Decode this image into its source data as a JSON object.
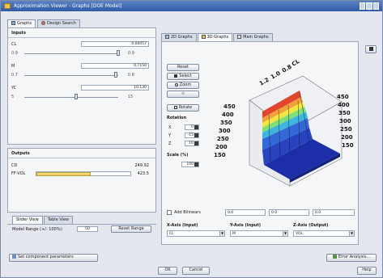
{
  "window": {
    "title": "Approximation Viewer - Graphs [DOE Model]"
  },
  "top_tabs": [
    {
      "label": "Graphs"
    },
    {
      "label": "Design Search"
    }
  ],
  "inputs": {
    "heading": "Inputs",
    "rows": [
      {
        "name": "CL",
        "value": "0.00057",
        "min": "0.9",
        "max": "0.9"
      },
      {
        "name": "M",
        "value": "0.7150",
        "min": "0.7",
        "max": "0.8"
      },
      {
        "name": "YC",
        "value": "10.130",
        "min": "5",
        "max": "15"
      }
    ]
  },
  "outputs": {
    "heading": "Outputs",
    "rows": [
      {
        "name": "CD",
        "value": "249.92"
      },
      {
        "name": "FF-VOL",
        "value": "423.5",
        "bar_fraction": 0.58
      }
    ]
  },
  "bottom_tabs": [
    {
      "label": "Slider View"
    },
    {
      "label": "Table View"
    }
  ],
  "model_range": {
    "label": "Model Range (+/- 100%):",
    "value": "50",
    "reset_label": "Reset Range"
  },
  "right_tabs": [
    {
      "label": "2D Graphs"
    },
    {
      "label": "3D Graphs"
    },
    {
      "label": "Main Graphs"
    }
  ],
  "controls": {
    "buttons": [
      "Reset",
      "Select",
      "Zoom",
      "Rotate"
    ],
    "rotation_heading": "Rotation",
    "rotation_axes": [
      {
        "axis": "X",
        "value": "0"
      },
      {
        "axis": "Y",
        "value": "-15"
      },
      {
        "axis": "Z",
        "value": "10"
      }
    ],
    "scale_heading": "Scale (%)",
    "scale_value": "100"
  },
  "chart": {
    "type": "surface-3d",
    "palette": [
      "#1c2fa8",
      "#3468d8",
      "#3fb6e0",
      "#7fe07a",
      "#f2e742",
      "#f3a23a",
      "#e0452f"
    ],
    "left_axis_ticks": [
      "450",
      "400",
      "350",
      "300",
      "250",
      "200",
      "150"
    ],
    "right_axis_ticks": [
      "450",
      "400",
      "350",
      "300",
      "250",
      "200",
      "150"
    ],
    "top_axis_label": "CL",
    "top_axis_ticks": [
      "1.2",
      "1.0",
      "0.8"
    ]
  },
  "grid_toggle": {
    "label": "Add Bilinears"
  },
  "readouts": {
    "x": "0.0",
    "y": "0.0",
    "z": "0.0"
  },
  "axes_selects": [
    {
      "label": "X-Axis (Input)",
      "value": "CL"
    },
    {
      "label": "Y-Axis (Input)",
      "value": "M"
    },
    {
      "label": "Z-Axis (Output)",
      "value": "VOL"
    }
  ],
  "footer": {
    "set_params": "Set component parameters",
    "error_analysis": "Error Analysis...",
    "ok": "OK",
    "cancel": "Cancel",
    "help": "Help"
  }
}
